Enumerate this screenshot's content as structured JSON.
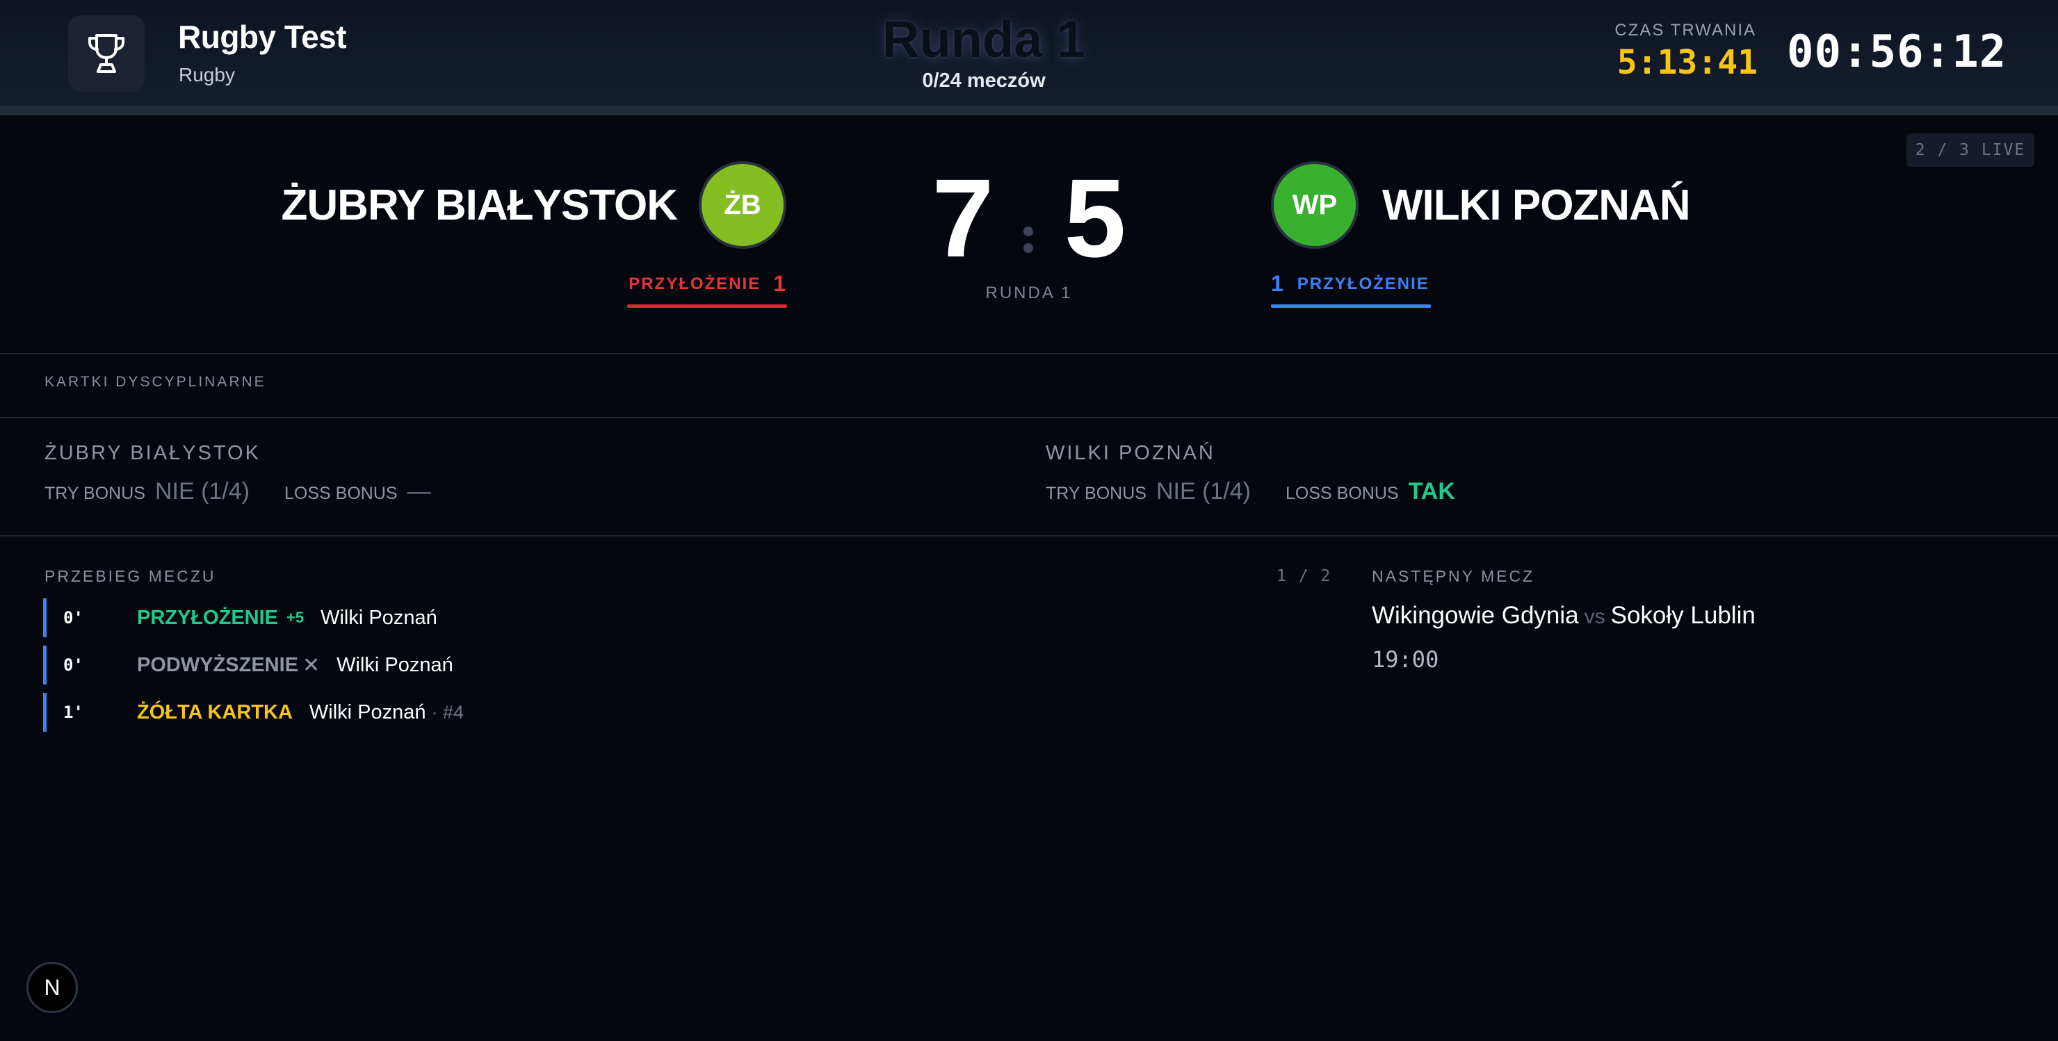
{
  "header": {
    "app_icon": "trophy-icon",
    "title": "Rugby Test",
    "subtitle": "Rugby",
    "round_title": "Runda 1",
    "round_progress": "0/24 meczów",
    "duration_label": "CZAS TRWANIA",
    "duration_value": "5:13:41",
    "clock": "00:56:12",
    "colors": {
      "duration": "#f5c518"
    }
  },
  "scoreboard": {
    "live_badge": "2 / 3 LIVE",
    "home": {
      "name": "ŻUBRY BIAŁYSTOK",
      "initials": "ŻB",
      "score": "7",
      "try_label": "PRZYŁOŻENIE",
      "try_count": "1",
      "color": "#86bd23",
      "accent": "#e5353b"
    },
    "away": {
      "name": "WILKI POZNAŃ",
      "initials": "WP",
      "score": "5",
      "try_label": "PRZYŁOŻENIE",
      "try_count": "1",
      "color": "#39b12e",
      "accent": "#3b82f6"
    },
    "round_caption": "RUNDA 1"
  },
  "cards": {
    "label": "KARTKI DYSCYPLINARNE"
  },
  "bonuses": {
    "home": {
      "team": "ŻUBRY BIAŁYSTOK",
      "try_bonus_label": "TRY BONUS",
      "try_bonus_value": "NIE (1/4)",
      "loss_bonus_label": "LOSS BONUS",
      "loss_bonus_value": "—"
    },
    "away": {
      "team": "WILKI POZNAŃ",
      "try_bonus_label": "TRY BONUS",
      "try_bonus_value": "NIE (1/4)",
      "loss_bonus_label": "LOSS BONUS",
      "loss_bonus_value": "TAK"
    }
  },
  "timeline": {
    "label": "PRZEBIEG MECZU",
    "events": [
      {
        "minute": "0'",
        "type": "PRZYŁOŻENIE",
        "points": "+5",
        "team": "Wilki Poznań"
      },
      {
        "minute": "0'",
        "type": "PODWYŻSZENIE",
        "mark": "✕",
        "team": "Wilki Poznań"
      },
      {
        "minute": "1'",
        "type": "ŻÓŁTA KARTKA",
        "team": "Wilki Poznań",
        "extra": "· #4"
      }
    ]
  },
  "next_match": {
    "page_counter": "1 / 2",
    "label": "NASTĘPNY MECZ",
    "home": "Wikingowie Gdynia",
    "vs": "vs",
    "away": "Sokoły Lublin",
    "time": "19:00"
  },
  "corner_button": {
    "label": "N"
  }
}
